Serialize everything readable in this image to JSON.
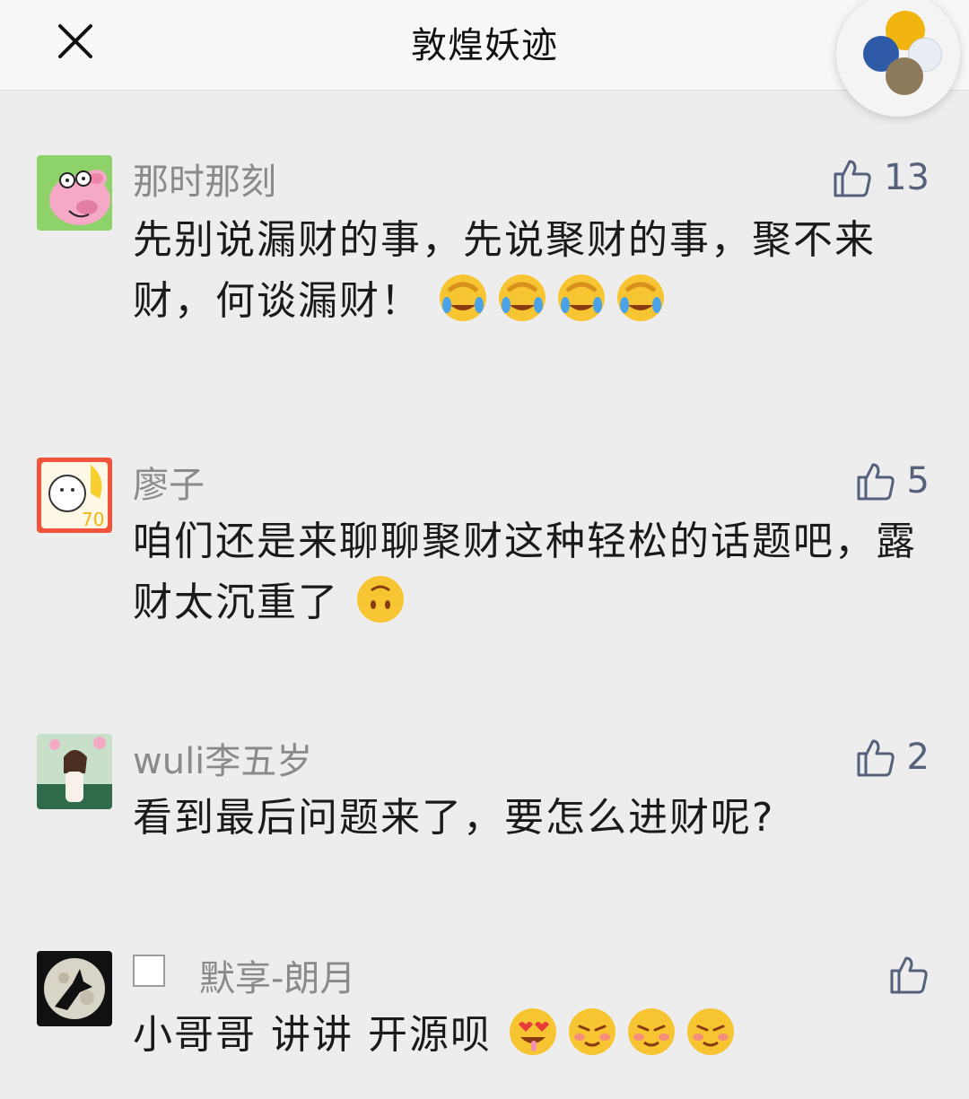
{
  "header": {
    "title": "敦煌妖迹",
    "close_icon": "close-icon",
    "floating_window_icon": "floating-window-bubble"
  },
  "colors": {
    "background": "#ededed",
    "nickname": "#8a8a8a",
    "like_accent": "#55617a",
    "text": "#1a1a1a"
  },
  "comments": [
    {
      "nickname": "那时那刻",
      "likes": "13",
      "text": "先别说漏财的事，先说聚财的事，聚不来财，何谈漏财！",
      "emojis": [
        "facepalm-laugh-emoji",
        "facepalm-laugh-emoji",
        "facepalm-laugh-emoji",
        "facepalm-laugh-emoji"
      ],
      "avatar_icon": "pig-avatar"
    },
    {
      "nickname": "廖子",
      "likes": "5",
      "text": "咱们还是来聊聊聚财这种轻松的话题吧，露财太沉重了",
      "emojis": [
        "upside-down-face-emoji"
      ],
      "avatar_icon": "cartoon-avatar"
    },
    {
      "nickname": "wuli李五岁",
      "likes": "2",
      "text": "看到最后问题来了，要怎么进财呢?",
      "emojis": [],
      "avatar_icon": "photo-avatar"
    },
    {
      "nickname": "默享-朗月",
      "likes": "",
      "text": "小哥哥 讲讲 开源呗",
      "emojis": [
        "heart-eyes-drool-emoji",
        "smirk-blush-emoji",
        "smirk-blush-emoji",
        "smirk-blush-emoji"
      ],
      "avatar_icon": "moon-eagle-avatar"
    }
  ]
}
